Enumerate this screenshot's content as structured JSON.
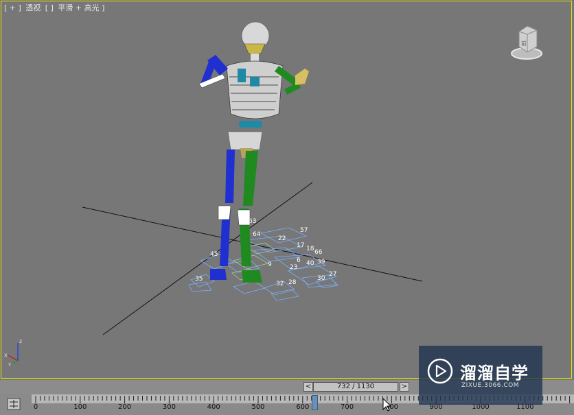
{
  "viewport": {
    "label_parts": [
      "[ + ]",
      "透视",
      "[ ]",
      "平滑 + 高光 ]"
    ]
  },
  "bip_numbers": [
    "63",
    "57",
    "64",
    "22",
    "17",
    "18",
    "66",
    "45",
    "35",
    "6",
    "30",
    "27",
    "28",
    "32",
    "23",
    "9",
    "40",
    "39"
  ],
  "viewcube": {
    "face_label": "前"
  },
  "axis_tripod": {
    "z": "z",
    "x": "x",
    "y": "y"
  },
  "time_slider": {
    "prev_label": "<",
    "next_label": ">",
    "frame_display": "732 / 1130",
    "current_frame": 732,
    "total_frames": 1130
  },
  "trackbar": {
    "ticks": [
      "0",
      "100",
      "200",
      "300",
      "400",
      "500",
      "600",
      "700",
      "800",
      "900",
      "1000",
      "1100"
    ]
  },
  "watermark": {
    "title": "溜溜自学",
    "url": "ZIXUE.3066.COM"
  },
  "colors": {
    "viewport_bg": "#777777",
    "active_border": "#e8e300",
    "left_limbs": "#1f2fd0",
    "right_limbs": "#1f8a1f",
    "spine": "#e8e8e8",
    "footstep": "#7ab0ff"
  }
}
